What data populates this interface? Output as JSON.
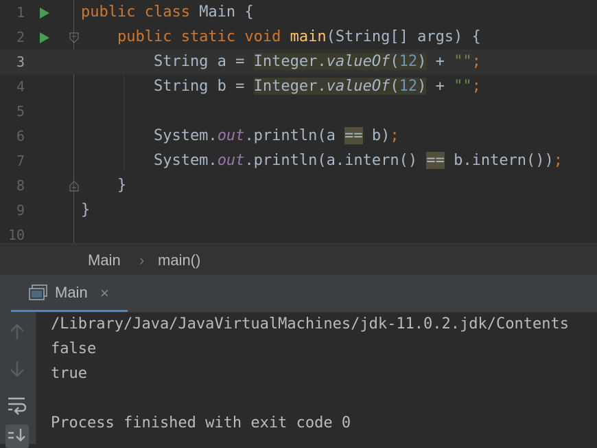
{
  "editor": {
    "lines": [
      {
        "num": "1",
        "tokens": [
          {
            "t": "public class ",
            "c": "kw"
          },
          {
            "t": "Main {",
            "c": ""
          }
        ]
      },
      {
        "num": "2",
        "tokens": [
          {
            "t": "    public static void ",
            "c": "kw"
          },
          {
            "t": "main",
            "c": "fn"
          },
          {
            "t": "(String[] args) {",
            "c": ""
          }
        ]
      },
      {
        "num": "3",
        "tokens": [
          {
            "t": "        String a = ",
            "c": ""
          },
          {
            "t": "Integer.",
            "c": "hl"
          },
          {
            "t": "valueOf",
            "c": "hl ital"
          },
          {
            "t": "(",
            "c": "hl"
          },
          {
            "t": "12",
            "c": "hl num"
          },
          {
            "t": ")",
            "c": "hl"
          },
          {
            "t": " + ",
            "c": ""
          },
          {
            "t": "\"\"",
            "c": "str"
          },
          {
            "t": ";",
            "c": "kw"
          }
        ]
      },
      {
        "num": "4",
        "tokens": [
          {
            "t": "        String b = ",
            "c": ""
          },
          {
            "t": "Integer.",
            "c": "hl"
          },
          {
            "t": "valueOf",
            "c": "hl ital"
          },
          {
            "t": "(",
            "c": "hl"
          },
          {
            "t": "12",
            "c": "hl num"
          },
          {
            "t": ")",
            "c": "hl"
          },
          {
            "t": " + ",
            "c": ""
          },
          {
            "t": "\"\"",
            "c": "str"
          },
          {
            "t": ";",
            "c": "kw"
          }
        ]
      },
      {
        "num": "5",
        "tokens": []
      },
      {
        "num": "6",
        "tokens": [
          {
            "t": "        System.",
            "c": ""
          },
          {
            "t": "out",
            "c": "fld"
          },
          {
            "t": ".println(a ",
            "c": ""
          },
          {
            "t": "==",
            "c": "hl2"
          },
          {
            "t": " b)",
            "c": ""
          },
          {
            "t": ";",
            "c": "kw"
          }
        ]
      },
      {
        "num": "7",
        "tokens": [
          {
            "t": "        System.",
            "c": ""
          },
          {
            "t": "out",
            "c": "fld"
          },
          {
            "t": ".println(a.intern() ",
            "c": ""
          },
          {
            "t": "==",
            "c": "hl2"
          },
          {
            "t": " b.intern())",
            "c": ""
          },
          {
            "t": ";",
            "c": "kw"
          }
        ]
      },
      {
        "num": "8",
        "tokens": [
          {
            "t": "    }",
            "c": ""
          }
        ]
      },
      {
        "num": "9",
        "tokens": [
          {
            "t": "}",
            "c": ""
          }
        ]
      },
      {
        "num": "10",
        "tokens": []
      }
    ],
    "current_line": 3
  },
  "breadcrumbs": {
    "items": [
      "Main",
      "main()"
    ],
    "separator": "›"
  },
  "run_panel": {
    "tab_label": "Main",
    "close_glyph": "×",
    "console_lines": [
      "/Library/Java/JavaVirtualMachines/jdk-11.0.2.jdk/Contents",
      "false",
      "true",
      "",
      "Process finished with exit code 0"
    ]
  },
  "colors": {
    "background": "#2b2b2b",
    "keyword": "#cc7832",
    "method": "#ffc66d",
    "number": "#6897bb",
    "string": "#6a8759",
    "field": "#9876aa",
    "run_arrow": "#499c54",
    "tab_underline": "#4a88c7"
  },
  "icons": {
    "run": "run-triangle-icon",
    "fold": "fold-marker-icon",
    "console_tab": "console-window-icon",
    "up": "arrow-up-icon",
    "down": "arrow-down-icon",
    "soft_wrap": "soft-wrap-icon",
    "scroll_end": "scroll-to-end-icon"
  }
}
